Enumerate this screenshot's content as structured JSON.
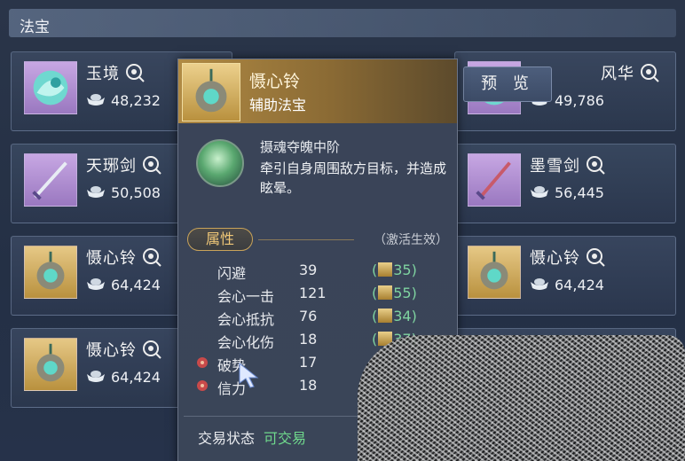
{
  "section": {
    "title": "法宝"
  },
  "items": [
    {
      "name": "玉境",
      "price": "48,232",
      "thumb": "purple",
      "art": "jade-orb-icon"
    },
    {
      "name": "天琊剑",
      "price": "50,508",
      "thumb": "purple",
      "art": "sword-icon"
    },
    {
      "name": "慑心铃",
      "price": "64,424",
      "thumb": "gold",
      "art": "bell-icon"
    },
    {
      "name": "慑心铃",
      "price": "64,424",
      "thumb": "gold",
      "art": "bell-icon"
    },
    {
      "name": "风华",
      "price": "49,786",
      "thumb": "purple",
      "art": "jade-orb-icon"
    },
    {
      "name": "墨雪剑",
      "price": "56,445",
      "thumb": "purple",
      "art": "sword-icon"
    },
    {
      "name": "慑心铃",
      "price": "64,424",
      "thumb": "gold",
      "art": "bell-icon"
    }
  ],
  "tooltip": {
    "title": "慑心铃",
    "subtitle": "辅助法宝",
    "skill_name": "摄魂夺魄中阶",
    "skill_desc": "牵引自身周围敌方目标，并造成眩晕。",
    "attr_title": "属性",
    "attr_note": "（激活生效）",
    "attributes": [
      {
        "label": "闪避",
        "value": "39",
        "bonus": "35",
        "marked": false
      },
      {
        "label": "会心一击",
        "value": "121",
        "bonus": "55",
        "marked": false
      },
      {
        "label": "会心抵抗",
        "value": "76",
        "bonus": "34",
        "marked": false
      },
      {
        "label": "会心化伤",
        "value": "18",
        "bonus": "37",
        "marked": false
      },
      {
        "label": "破势",
        "value": "17",
        "bonus": "",
        "marked": true
      },
      {
        "label": "信力",
        "value": "18",
        "bonus": "",
        "marked": true
      }
    ],
    "trade_label": "交易状态",
    "trade_value": "可交易"
  },
  "preview_button": "预 览",
  "colors": {
    "accent_gold": "#c9a35a",
    "bonus_green": "#7fd3a0",
    "tradable_green": "#6fd88c"
  }
}
